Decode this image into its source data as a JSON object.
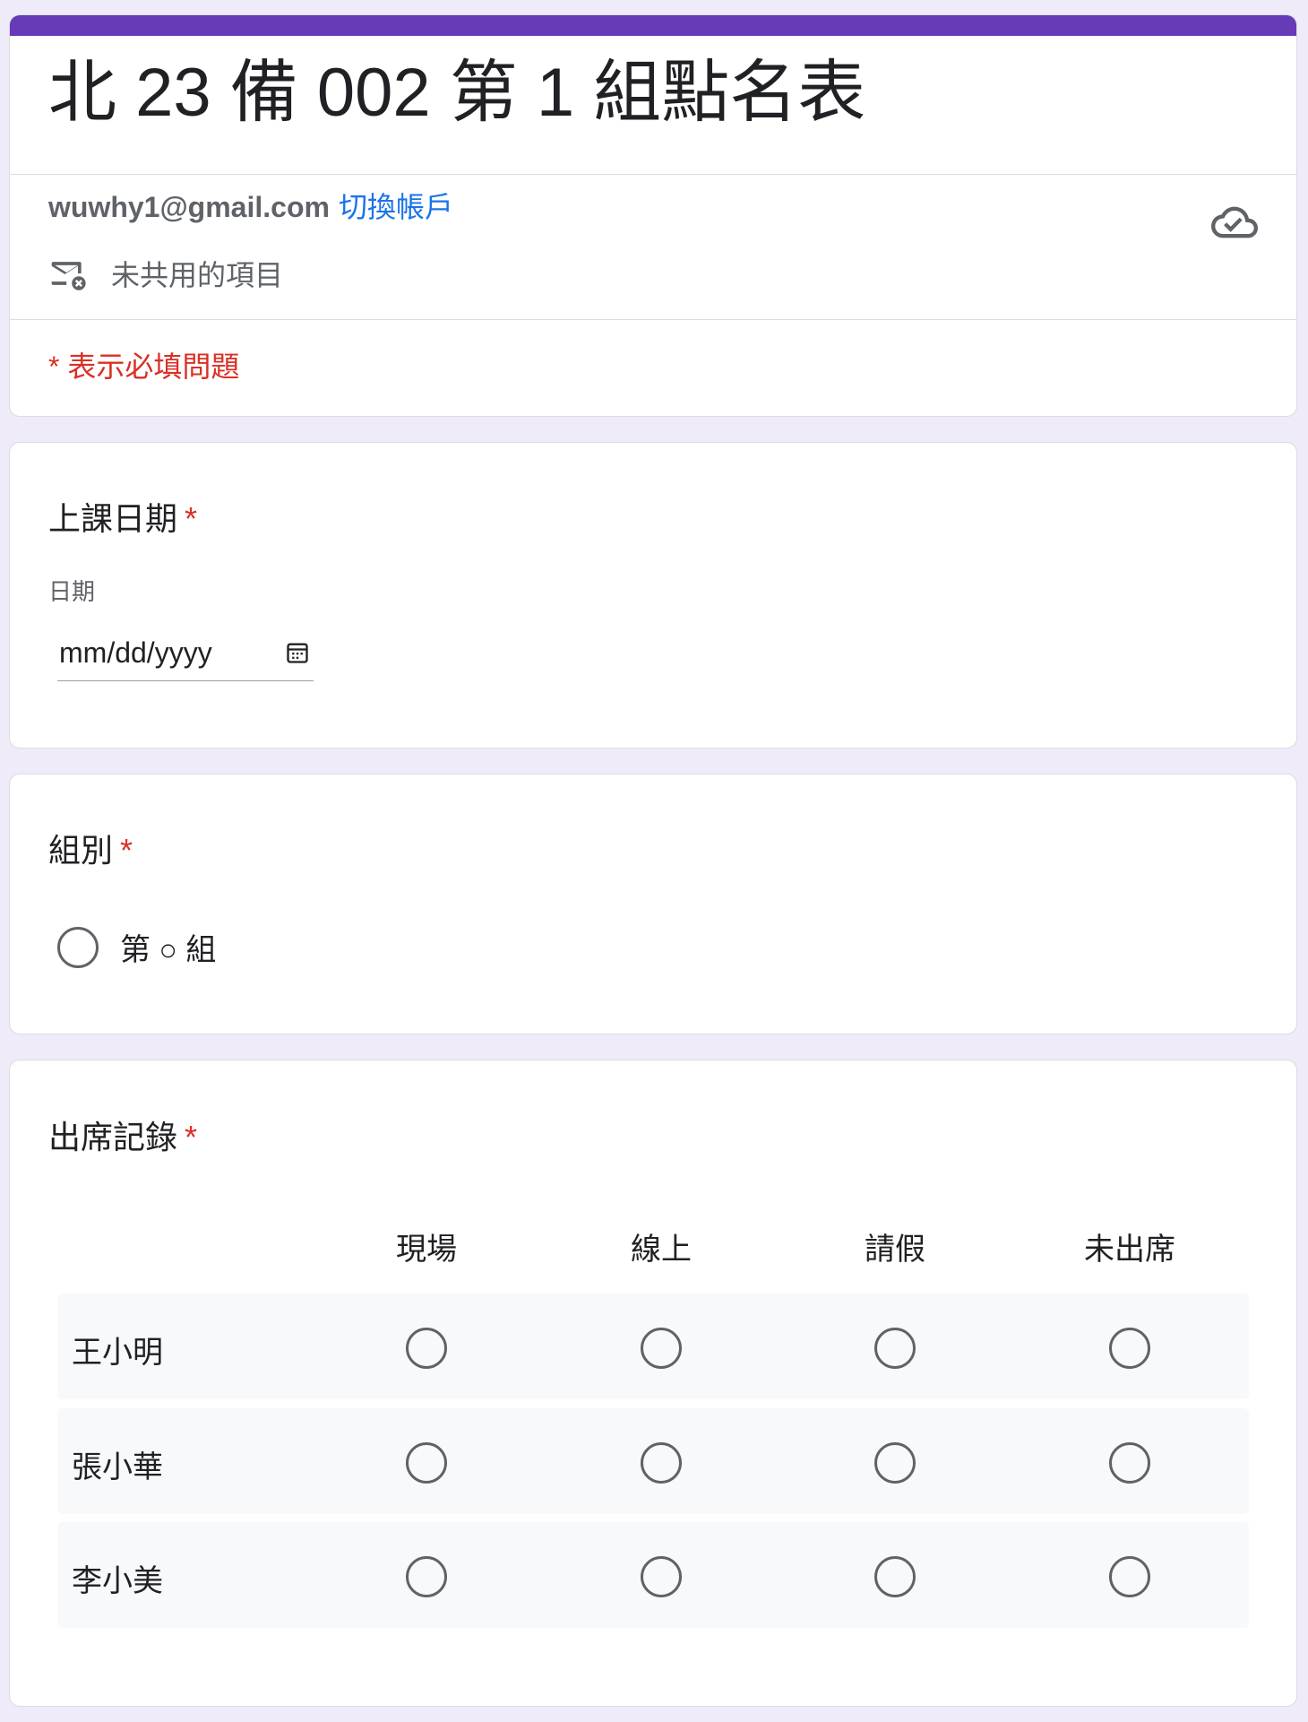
{
  "form": {
    "title": "北 23 備 002 第 1 組點名表",
    "account_email": "wuwhy1@gmail.com",
    "switch_account": "切換帳戶",
    "not_shared": "未共用的項目",
    "required_note": "* 表示必填問題"
  },
  "questions": {
    "date": {
      "title": "上課日期",
      "required_mark": "*",
      "sub_label": "日期",
      "placeholder": "mm/dd/yyyy"
    },
    "group": {
      "title": "組別",
      "required_mark": "*",
      "option_label": "第 ○ 組"
    },
    "attendance": {
      "title": "出席記錄",
      "required_mark": "*",
      "columns": [
        "現場",
        "線上",
        "請假",
        "未出席"
      ],
      "rows": [
        "王小明",
        "張小華",
        "李小美"
      ]
    }
  },
  "colors": {
    "theme": "#673ab7",
    "background": "#f0ebf8",
    "required": "#d93025",
    "link": "#1a73e8"
  }
}
